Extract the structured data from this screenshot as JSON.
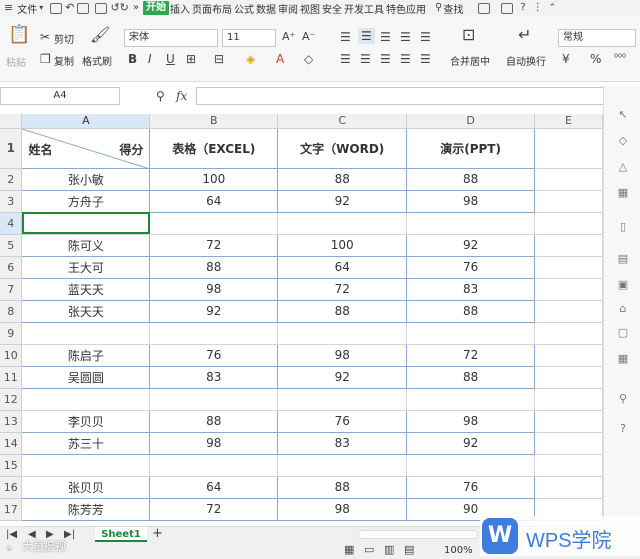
{
  "menubar": {
    "file": "文件",
    "tabs": [
      "开始",
      "插入",
      "页面布局",
      "公式",
      "数据",
      "审阅",
      "视图",
      "安全",
      "开发工具",
      "特色应用"
    ],
    "active_tab": "开始",
    "search": "查找"
  },
  "ribbon": {
    "paste": "粘贴",
    "cut": "剪切",
    "copy": "复制",
    "format_painter": "格式刷",
    "font_name": "宋体",
    "font_size": "11",
    "merge_center": "合并居中",
    "wrap_text": "自动换行",
    "number_format": "常规"
  },
  "formula_bar": {
    "name_box": "A4",
    "fx": "fx"
  },
  "columns": [
    "A",
    "B",
    "C",
    "D",
    "E"
  ],
  "header_row": {
    "row": "1",
    "a_name": "姓名",
    "a_score": "得分",
    "b": "表格（EXCEL)",
    "c": "文字（WORD)",
    "d": "演示(PPT)"
  },
  "rows": [
    {
      "n": "2",
      "name": "张小敏",
      "excel": "100",
      "word": "88",
      "ppt": "88"
    },
    {
      "n": "3",
      "name": "方舟子",
      "excel": "64",
      "word": "92",
      "ppt": "98"
    },
    {
      "n": "4",
      "name": "",
      "excel": "",
      "word": "",
      "ppt": ""
    },
    {
      "n": "5",
      "name": "陈可义",
      "excel": "72",
      "word": "100",
      "ppt": "92"
    },
    {
      "n": "6",
      "name": "王大可",
      "excel": "88",
      "word": "64",
      "ppt": "76"
    },
    {
      "n": "7",
      "name": "蓝天天",
      "excel": "98",
      "word": "72",
      "ppt": "83"
    },
    {
      "n": "8",
      "name": "张天天",
      "excel": "92",
      "word": "88",
      "ppt": "88"
    },
    {
      "n": "9",
      "name": "",
      "excel": "",
      "word": "",
      "ppt": ""
    },
    {
      "n": "10",
      "name": "陈启子",
      "excel": "76",
      "word": "98",
      "ppt": "72"
    },
    {
      "n": "11",
      "name": "吴圆圆",
      "excel": "83",
      "word": "92",
      "ppt": "88"
    },
    {
      "n": "12",
      "name": "",
      "excel": "",
      "word": "",
      "ppt": ""
    },
    {
      "n": "13",
      "name": "李贝贝",
      "excel": "88",
      "word": "76",
      "ppt": "98"
    },
    {
      "n": "14",
      "name": "苏三十",
      "excel": "98",
      "word": "83",
      "ppt": "92"
    },
    {
      "n": "15",
      "name": "",
      "excel": "",
      "word": "",
      "ppt": ""
    },
    {
      "n": "16",
      "name": "张贝贝",
      "excel": "64",
      "word": "88",
      "ppt": "76"
    },
    {
      "n": "17",
      "name": "陈芳芳",
      "excel": "72",
      "word": "98",
      "ppt": "90"
    }
  ],
  "sheet_tab": "Sheet1",
  "add_sheet": "+",
  "watermark": "大鼠摄视",
  "zoom": "100%",
  "wps_logo_text": "WPS学院",
  "colors": {
    "accent": "#2fa84f",
    "selection": "#1a8a3a",
    "wps_blue": "#3d7de0"
  }
}
